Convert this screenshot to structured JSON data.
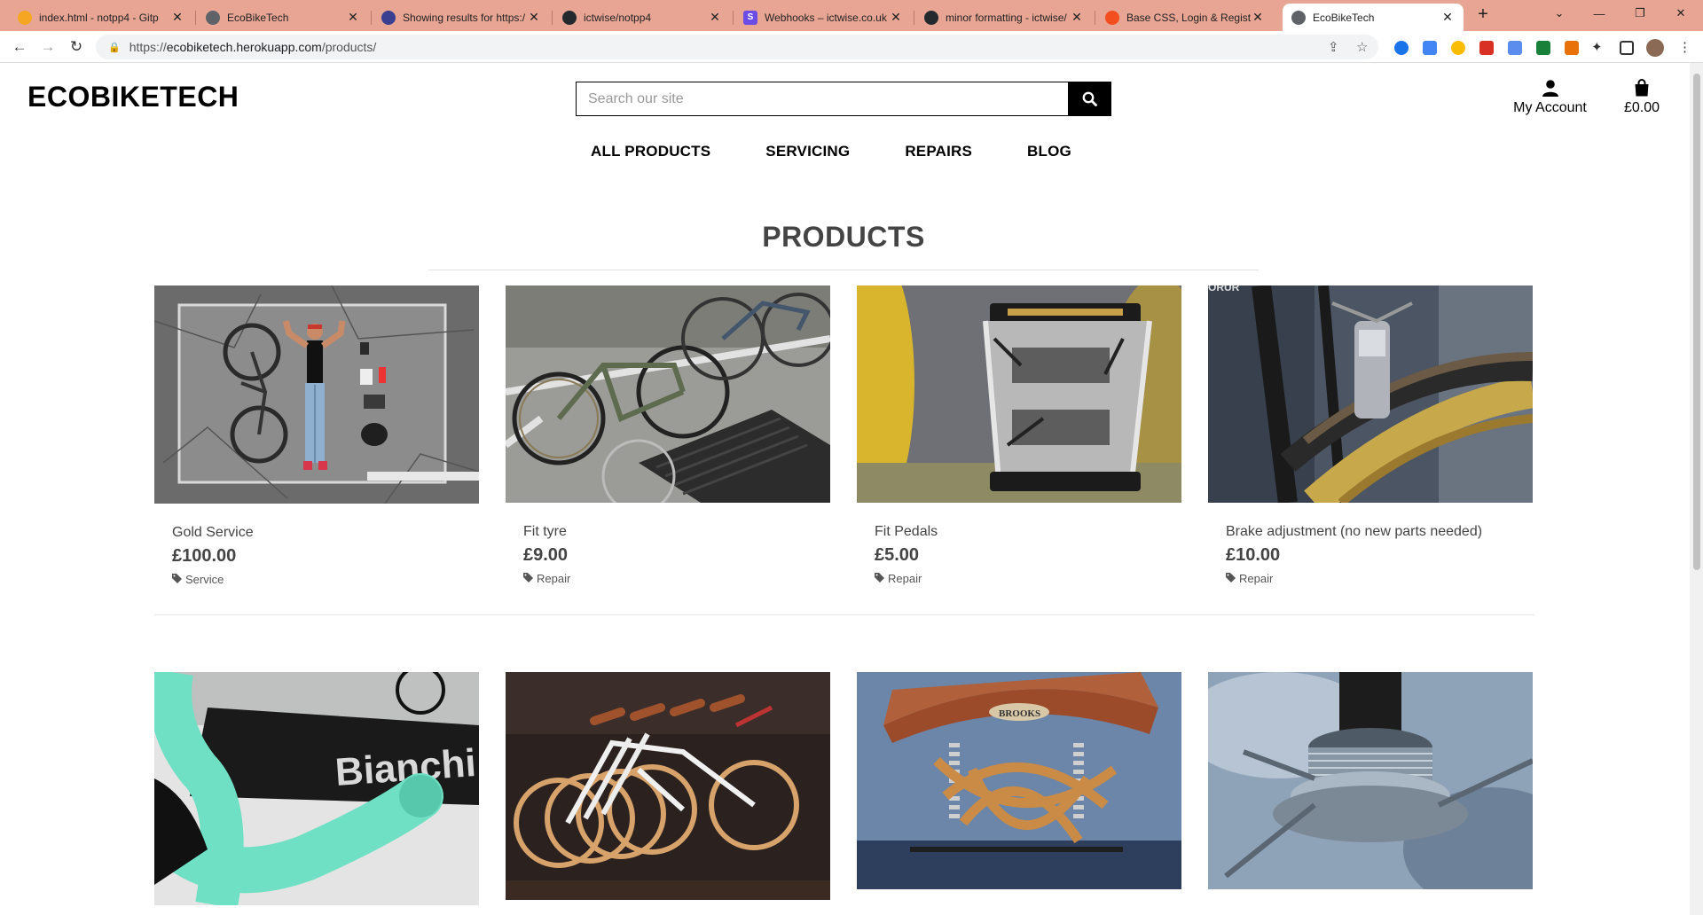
{
  "browser": {
    "tabs": [
      {
        "title": "index.html - notpp4 - Gitp",
        "icon_color": "#f5a623",
        "active": false
      },
      {
        "title": "EcoBikeTech",
        "icon_color": "#5f6368",
        "active": false
      },
      {
        "title": "Showing results for https:/",
        "icon_color": "#3b3f8f",
        "active": false
      },
      {
        "title": "ictwise/notpp4",
        "icon_color": "#24292e",
        "active": false
      },
      {
        "title": "Webhooks – ictwise.co.uk",
        "icon_color": "#6b4ce6",
        "active": false
      },
      {
        "title": "minor formatting - ictwise/",
        "icon_color": "#24292e",
        "active": false
      },
      {
        "title": "Base CSS, Login & Registra",
        "icon_color": "#f24e1e",
        "active": false
      },
      {
        "title": "EcoBikeTech",
        "icon_color": "#5f6368",
        "active": true
      }
    ],
    "url_prefix": "https://",
    "url_host": "ecobiketech.herokuapp.com",
    "url_path": "/products/"
  },
  "header": {
    "brand": "ECOBIKETECH",
    "search_placeholder": "Search our site",
    "account_label": "My Account",
    "bag_total": "£0.00"
  },
  "nav": [
    "ALL PRODUCTS",
    "SERVICING",
    "REPAIRS",
    "BLOG"
  ],
  "main": {
    "title": "PRODUCTS",
    "products": [
      {
        "name": "Gold Service",
        "price": "£100.00",
        "category": "Service",
        "image": "man-lying-with-bike"
      },
      {
        "name": "Fit tyre",
        "price": "£9.00",
        "category": "Repair",
        "image": "bikes-at-rack"
      },
      {
        "name": "Fit Pedals",
        "price": "£5.00",
        "category": "Repair",
        "image": "bike-pedal"
      },
      {
        "name": "Brake adjustment (no new parts needed)",
        "price": "£10.00",
        "category": "Repair",
        "image": "bike-brake"
      },
      {
        "name": "",
        "price": "",
        "category": "",
        "image": "bianchi-handlebar"
      },
      {
        "name": "",
        "price": "",
        "category": "",
        "image": "white-bikes-row"
      },
      {
        "name": "",
        "price": "",
        "category": "",
        "image": "brooks-saddle"
      },
      {
        "name": "",
        "price": "",
        "category": "",
        "image": "headset-bearing"
      }
    ]
  },
  "colors": {
    "tabbar": "#e8a594",
    "text": "#444444",
    "black": "#000000"
  }
}
